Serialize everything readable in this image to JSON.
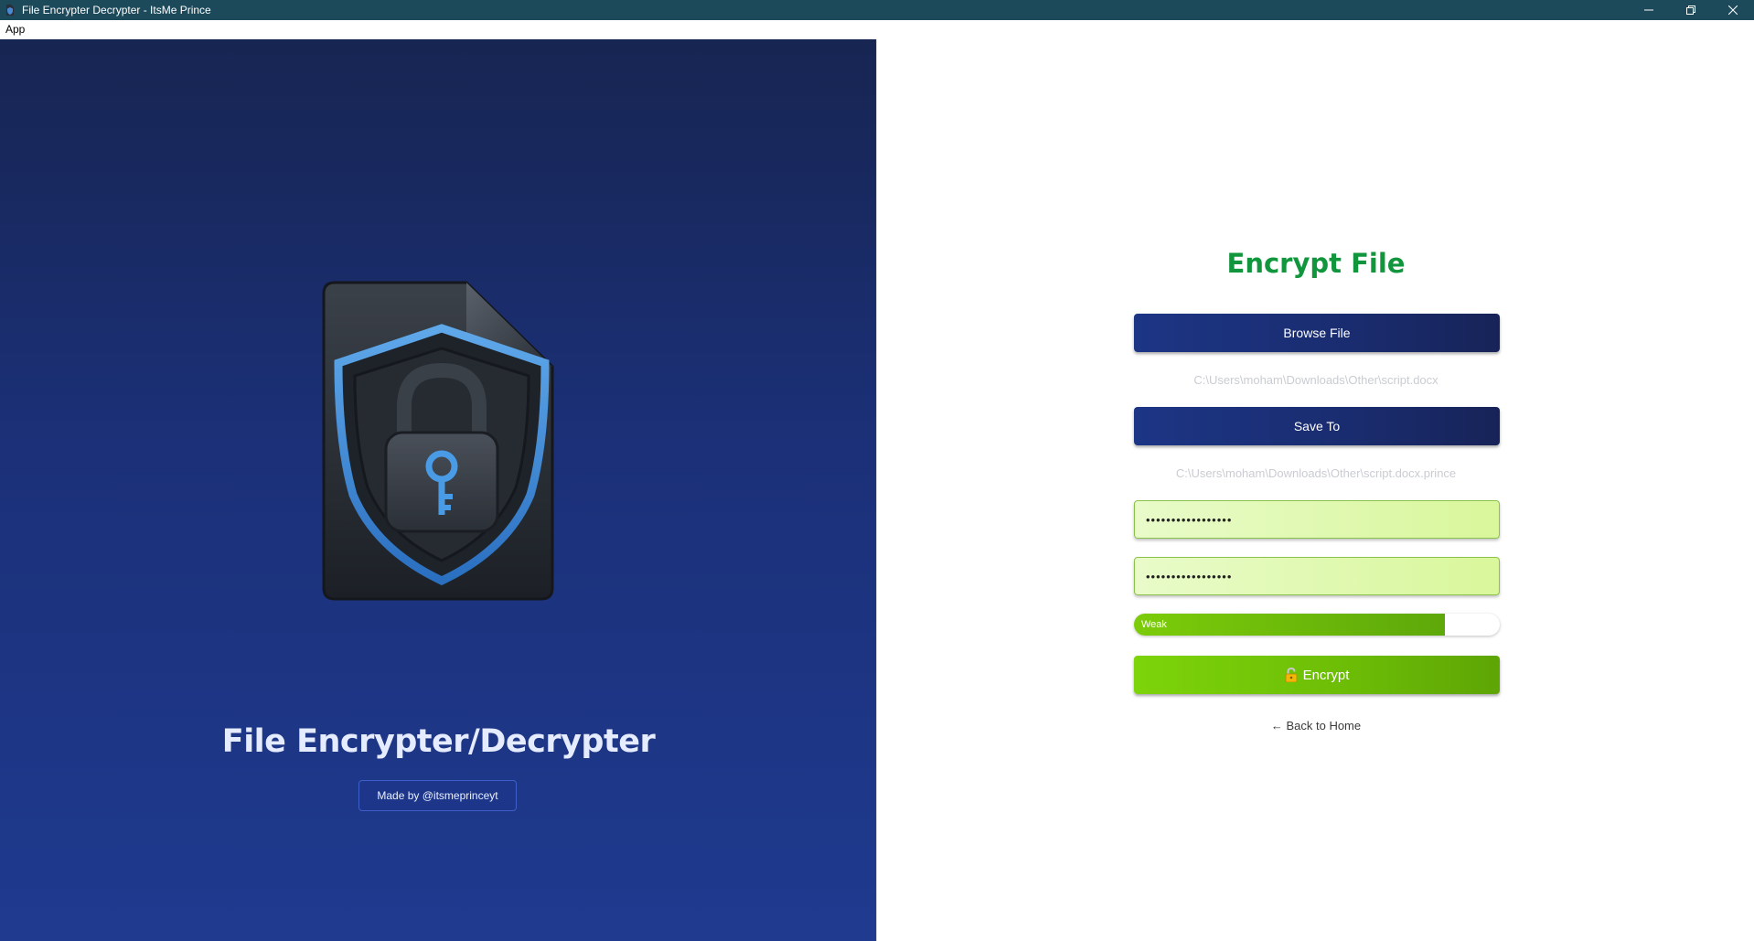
{
  "window": {
    "title": "File Encrypter Decrypter - ItsMe Prince",
    "controls": [
      "minimize-icon",
      "restore-icon",
      "close-icon"
    ]
  },
  "menu": {
    "items": [
      {
        "label": "App"
      }
    ]
  },
  "hero": {
    "icon": "shield-lock-file-icon",
    "title": "File Encrypter/Decrypter",
    "credit": "Made by @itsmeprinceyt"
  },
  "form": {
    "title": "Encrypt File",
    "browse_label": "Browse File",
    "source_path": "C:\\Users\\moham\\Downloads\\Other\\script.docx",
    "save_label": "Save To",
    "dest_path": "C:\\Users\\moham\\Downloads\\Other\\script.docx.prince",
    "password_mask": "•••••••••••••••••",
    "confirm_mask": "•••••••••••••••••",
    "strength": {
      "label": "Weak",
      "fraction": 0.85
    },
    "encrypt_label": "Encrypt",
    "encrypt_icon": "lock-icon",
    "back_label": "← Back to Home"
  },
  "colors": {
    "titlebar": "#1c4a5b",
    "left_panel": "#1b3078",
    "form_title": "#11953d",
    "primary_button": "#1c3585",
    "encrypt_button": "#6cbc06",
    "password_field": "#d9f79b"
  }
}
